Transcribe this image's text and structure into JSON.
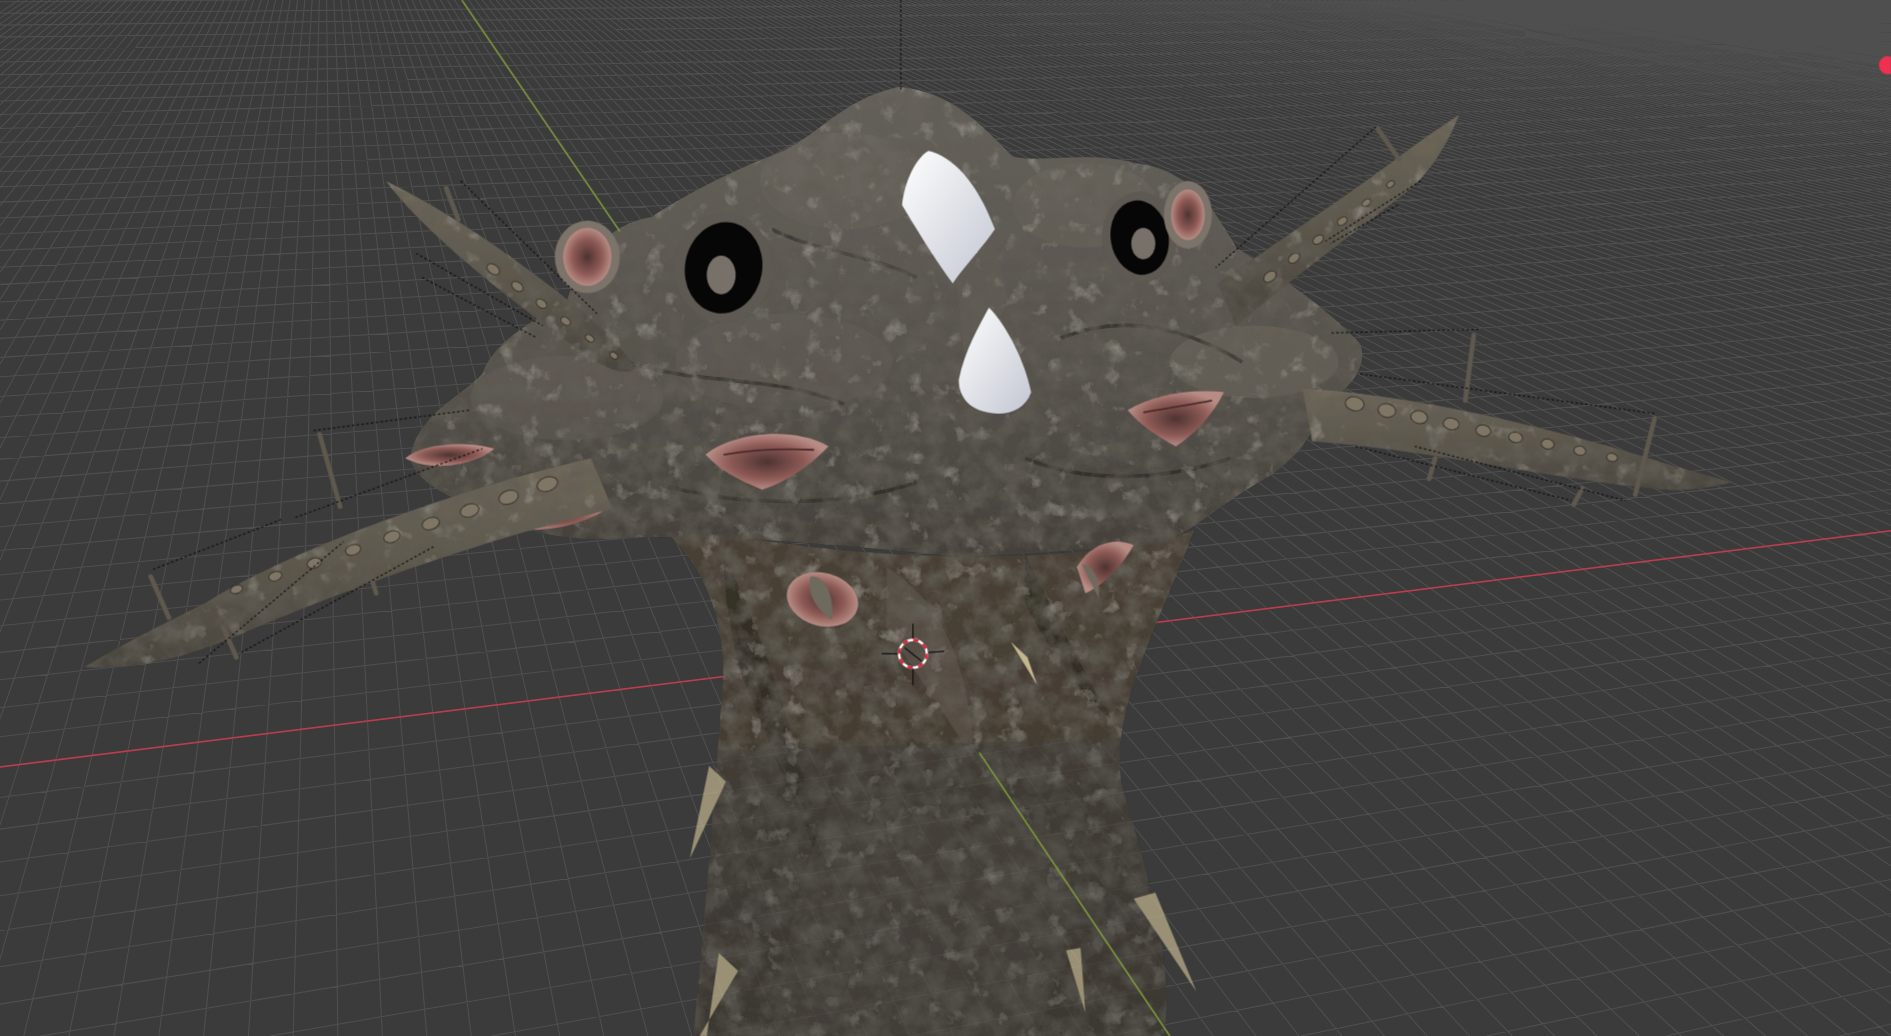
{
  "viewport": {
    "floor_grid": true,
    "axes": [
      {
        "kind": "x",
        "color": "#c23a4f"
      },
      {
        "kind": "y",
        "color": "#7f9b3b"
      }
    ]
  }
}
